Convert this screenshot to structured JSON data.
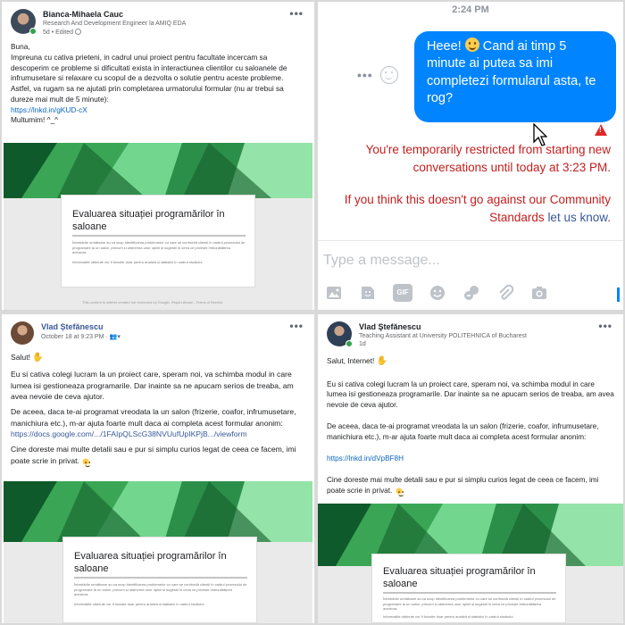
{
  "post1": {
    "author": "Bianca-Mihaela Cauc",
    "headline": "Research And Development Engineer la AMIQ EDA",
    "meta": "5d • Edited",
    "greeting": "Buna,",
    "paragraph1": "Impreuna cu cativa prieteni, in cadrul unui proiect pentru facultate incercam sa descoperim ce probleme si dificultati exista in interactiunea clientilor cu saloanele de infrumusetare si relaxare cu scopul de a dezvolta o solutie pentru aceste probleme.",
    "paragraph2": "Astfel, va rugam sa ne ajutati prin completarea urmatorului formular (nu ar trebui sa dureze mai mult de 5 minute):",
    "link": "https://lnkd.in/gKUD-cX",
    "thanks": "Multumim! ^_^",
    "preview_title": "Evaluarea situației programărilor în saloane",
    "preview_desc": "Întrebările următoare au ca scop identificarea problemelor cu care se confruntă clienții în cadrul procesului de programare la un salon, precum și obținerea unor opinii și sugestii în ceea ce privește îmbunătățirea acestora.",
    "preview_note": "Informațiile obținute vor fi folosite doar pentru analiză și statistici în cadrul studiului.",
    "preview_footer": "This content is neither created nor endorsed by Google. Report Abuse - Terms of Service"
  },
  "messenger": {
    "time": "2:24 PM",
    "bubble_before": "Heee! ",
    "bubble_after": " Cand ai timp 5 minute ai putea sa imi completezi formularul asta, te rog?",
    "restriction": "You're temporarily restricted from starting new conversations until today at 3:23 PM.",
    "standards_prefix": "If you think this doesn't go against our Community Standards",
    "standards_link": "let us know",
    "standards_suffix": ".",
    "compose_placeholder": "Type a message...",
    "toolbar_icons": [
      "photo-icon",
      "sticker-icon",
      "gif-icon",
      "emoji-icon",
      "game-icon",
      "attachment-icon",
      "camera-icon"
    ],
    "gif_label": "GIF"
  },
  "post3": {
    "author": "Vlad Ștefănescu",
    "meta": "October 18 at 9:23 PM · ",
    "greeting": "Salut! ",
    "paragraph1": "Eu si cativa colegi lucram la un proiect care, speram noi, va schimba modul in care lumea isi gestioneaza programarile. Dar inainte sa ne apucam serios de treaba, am avea nevoie de ceva ajutor.",
    "paragraph2": "De aceea, daca te-ai programat vreodata la un salon (frizerie, coafor, infrumusetare, manichiura etc.), m-ar ajuta foarte mult daca ai completa acest formular anonim:",
    "link": "https://docs.google.com/.../1FAIpQLScG38NVUufUpIKPjB.../viewform",
    "paragraph3": "Cine doreste mai multe detalii sau e pur si simplu curios legat de ceea ce facem, imi poate scrie in privat. ",
    "preview_title": "Evaluarea situației programărilor în saloane",
    "preview_desc": "Întrebările următoare au ca scop identificarea problemelor cu care se confruntă clienții în cadrul procesului de programare la un salon, precum și obținerea unor opinii și sugestii în ceea ce privește îmbunătățirea acestora.",
    "preview_note": "Informațiile obținute vor fi folosite doar pentru analiză și statistici în cadrul studiului."
  },
  "post4": {
    "author": "Vlad Ştefănescu",
    "headline": "Teaching Assistant at University POLITEHNICA of Bucharest",
    "meta": "1d",
    "greeting": "Salut, Internet! ",
    "paragraph1": "Eu si cativa colegi lucram la un proiect care, speram noi, va schimba modul in care lumea isi gestioneaza programarile. Dar inainte sa ne apucam serios de treaba, am avea nevoie de ceva ajutor.",
    "paragraph2": "De aceea, daca te-ai programat vreodata la un salon (frizerie, coafor, infrumusetare, manichiura etc.), m-ar ajuta foarte mult daca ai completa acest formular anonim:",
    "link": "https://lnkd.in/dVpBF8H",
    "paragraph3": "Cine doreste mai multe detalii sau e pur si simplu curios legat de ceea ce facem, imi poate scrie in privat. ",
    "preview_title": "Evaluarea situației programărilor în saloane",
    "preview_desc": "Întrebările următoare au ca scop identificarea problemelor cu care se confruntă clienții în cadrul procesului de programare la un salon, precum și obținerea unor opinii și sugestii în ceea ce privește îmbunătățirea acestora.",
    "preview_note": "Informațiile obținute vor fi folosite doar pentru analiză și statistici în cadrul studiului."
  },
  "colors": {
    "linkedin_link": "#0a66c2",
    "facebook_link": "#385898",
    "messenger_blue": "#0084ff",
    "restriction_red": "#c41e1e",
    "online_green": "#31a24c"
  }
}
